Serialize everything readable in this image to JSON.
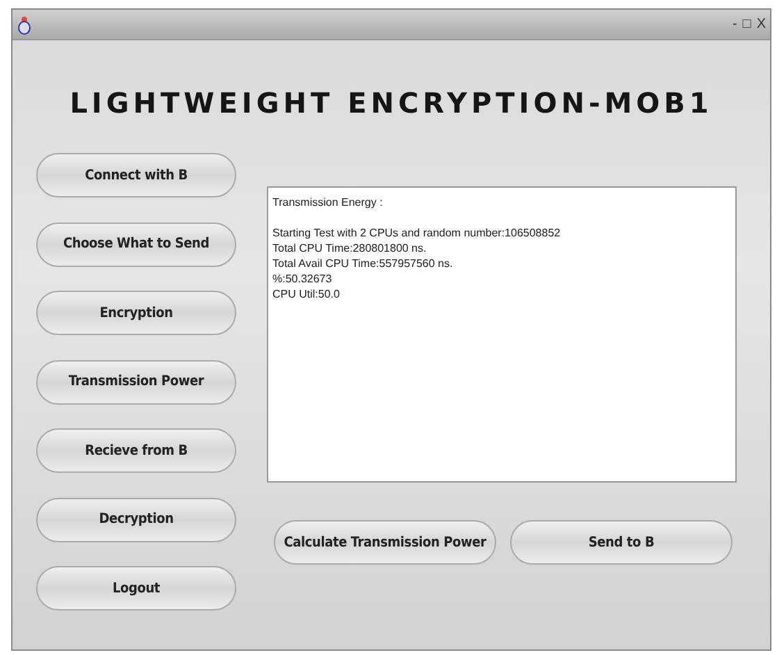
{
  "window": {
    "controls": [
      "-",
      "□",
      "X"
    ]
  },
  "title": "LIGHTWEIGHT ENCRYPTION-MOB1",
  "side_buttons": [
    "Connect with B",
    "Choose What to Send",
    "Encryption",
    "Transmission Power",
    "Recieve from B",
    "Decryption",
    "Logout"
  ],
  "output_heading": "Transmission Energy :",
  "output_lines": [
    "Starting Test with 2 CPUs and random number:106508852",
    "Total CPU Time:280801800 ns.",
    "Total Avail CPU Time:557957560 ns.",
    "%:50.32673",
    "CPU Util:50.0"
  ],
  "bottom_buttons": [
    "Calculate Transmission Power",
    "Send to B"
  ]
}
